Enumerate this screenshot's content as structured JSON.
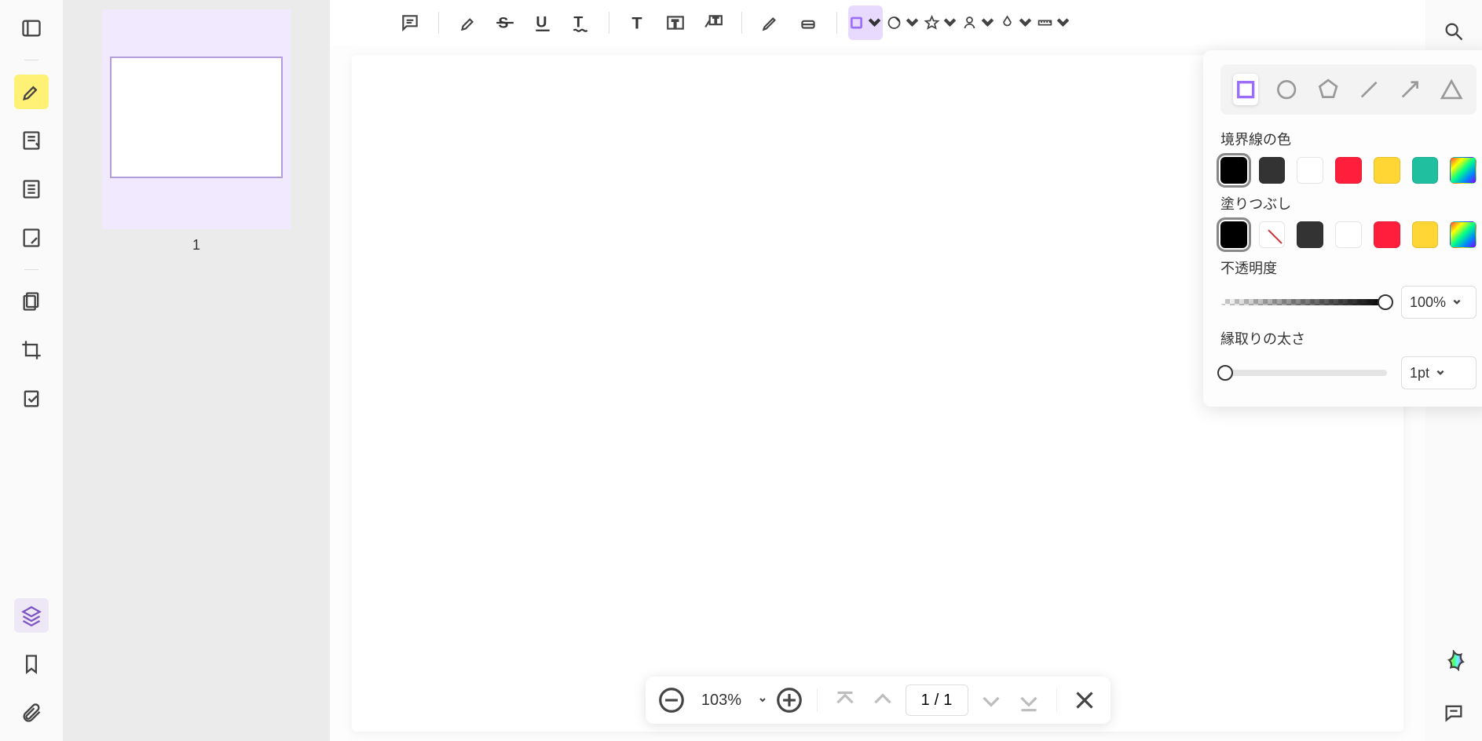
{
  "thumbnail": {
    "label": "1"
  },
  "popover": {
    "border_label": "境界線の色",
    "fill_label": "塗りつぶし",
    "opacity_label": "不透明度",
    "thickness_label": "縁取りの太さ",
    "opacity_value": "100%",
    "thickness_value": "1pt",
    "border_colors": [
      "#000000",
      "#333333",
      "#ffffff",
      "#ff1f3d",
      "#ffd633",
      "#1fbf9f"
    ],
    "fill_colors": [
      "#000000",
      "none",
      "#333333",
      "#ffffff",
      "#ff1f3d",
      "#ffd633"
    ]
  },
  "nav": {
    "zoom": "103%",
    "page_current": "1",
    "page_sep": "/",
    "page_total": "1"
  }
}
